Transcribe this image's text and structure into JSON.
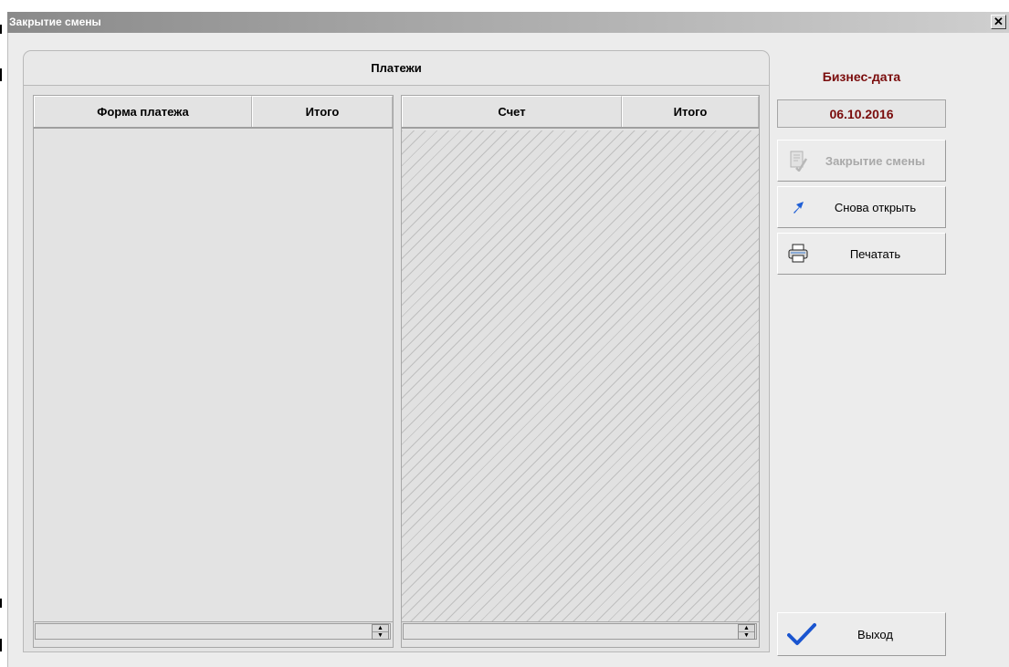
{
  "window": {
    "title": "Закрытие смены",
    "close_glyph": "✕"
  },
  "payments": {
    "tab_label": "Платежи",
    "left_grid": {
      "columns": [
        "Форма платежа",
        "Итого"
      ]
    },
    "right_grid": {
      "columns": [
        "Счет",
        "Итого"
      ]
    }
  },
  "business_date": {
    "label": "Бизнес-дата",
    "value": "06.10.2016",
    "color": "#7a0c0c"
  },
  "actions": {
    "close_shift": {
      "label": "Закрытие смены",
      "icon": "edit-document-icon",
      "enabled": false
    },
    "reopen": {
      "label": "Снова открыть",
      "icon": "arrow-up-right-icon"
    },
    "print": {
      "label": "Печатать",
      "icon": "printer-icon"
    },
    "exit": {
      "label": "Выход",
      "icon": "checkmark-icon"
    }
  }
}
